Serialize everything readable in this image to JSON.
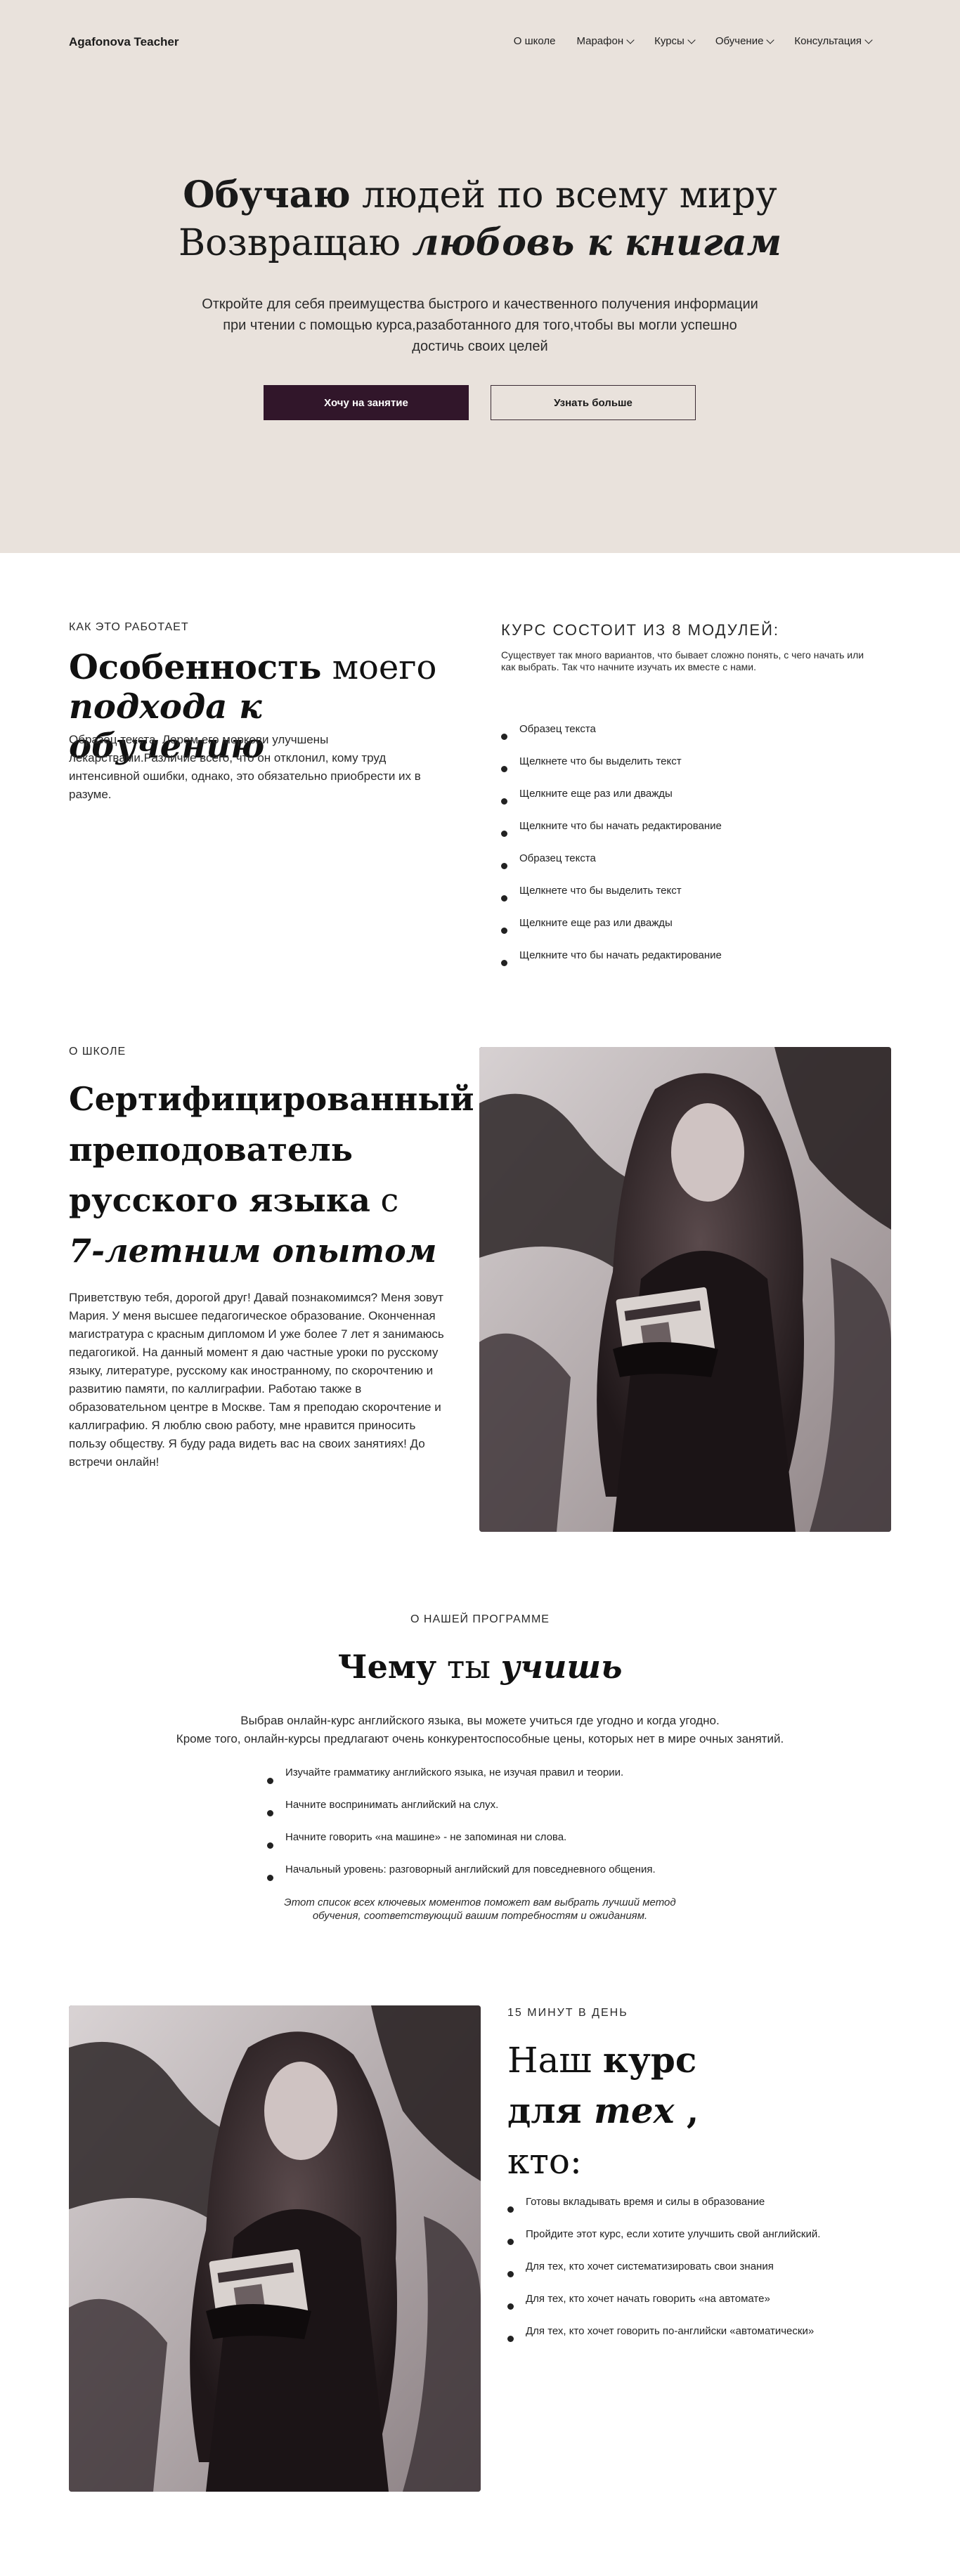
{
  "header": {
    "brand": "Agafonova Teacher",
    "nav": [
      "О школе",
      "Марафон",
      "Курсы",
      "Обучение",
      "Консультация"
    ]
  },
  "hero": {
    "line1_bold": "Обучаю",
    "line1_rest": " людей по всему миру",
    "line2_start": "Возвращаю ",
    "line2_italic": "любовь к книгам",
    "subtitle": "Откройте для себя преимущества быстрого и качественного получения информации при чтении с помощью курса,разаботанного для того,чтобы вы могли успешно достичь своих целей",
    "primary_button": "Хочу на занятие",
    "secondary_button": "Узнать больше"
  },
  "how": {
    "eyebrow": "Как это работает",
    "title_bold": "Особенность",
    "title_rest": " моего",
    "title_italic": "подхода к обучению",
    "text": "Образец текста. Лорем его моркови улучшены лекарствами.Различие всего, что он отклонил, кому труд интенсивной ошибки, однако, это обязательно приобрести их в разуме."
  },
  "modules": {
    "heading": "Курс состоит из 8 модулей:",
    "intro": "Существует так много вариантов, что бывает сложно понять, с чего начать или как выбрать. Так что начните изучать их вместе с нами.",
    "items": [
      "Образец текста",
      "Щелкнете что бы выделить текст",
      "Щелкните еще раз или дважды",
      "Щелкните что бы начать редактирование",
      "Образец текста",
      "Щелкнете что бы выделить текст",
      "Щелкните еще раз или дважды",
      "Щелкните что бы начать редактирование"
    ]
  },
  "school": {
    "eyebrow": "О школе",
    "title_l1": "Сертифицированный",
    "title_l2": "преподователь",
    "title_l3": "русского языка",
    "title_l3_tail": " с",
    "title_l4": "7-летним опытом",
    "text": "Приветствую тебя, дорогой друг! Давай познакомимся? Меня зовут Мария. У меня высшее педагогическое образование. Оконченная магистратура с красным дипломом И уже более 7 лет я занимаюсь педагогикой. На данный момент я даю частные уроки по русскому языку, литературе, русскому как иностранному, по скорочтению и развитию памяти, по каллиграфии. Работаю также в образовательном центре в Москве. Там я преподаю скорочтение и каллиграфию. Я люблю свою работу, мне нравится приносить пользу обществу. Я буду рада видеть вас на своих занятиях! До встречи онлайн!"
  },
  "program": {
    "eyebrow": "О нашей программе",
    "title_bold": "Чему",
    "title_mid": " ты ",
    "title_italic": "учишь",
    "intro_l1": "Выбрав онлайн-курс английского языка, вы можете учиться где угодно и когда угодно.",
    "intro_l2": "Кроме того, онлайн-курсы предлагают очень конкурентоспособные цены, которых нет в мире очных занятий.",
    "items": [
      "Изучайте грамматику английского языка, не изучая правил и теории.",
      "Начните воспринимать английский на слух.",
      "Начните говорить «на машине» - не запоминая ни слова.",
      "Начальный уровень: разговорный английский для повседневного общения."
    ],
    "note": "Этот список всех ключевых моментов поможет вам выбрать лучший метод обучения, соответствующий вашим потребностям и ожиданиям."
  },
  "audience": {
    "eyebrow": "15 минут в день",
    "title_a": "Наш ",
    "title_b": "курс",
    "title_c": "для ",
    "title_d": "тех",
    "title_e": " ,",
    "title_f": "кто:",
    "items": [
      "Готовы вкладывать время и силы в образование",
      "Пройдите этот курс, если хотите улучшить свой английский.",
      "Для тех, кто хочет систематизировать свои знания",
      "Для тех, кто хочет начать говорить «на автомате»",
      "Для тех, кто хочет говорить по-английски «автоматически»"
    ]
  },
  "colors": {
    "hero_bg": "#e9e2dc",
    "accent": "#31162a",
    "photo_tone": "#3b3336"
  }
}
